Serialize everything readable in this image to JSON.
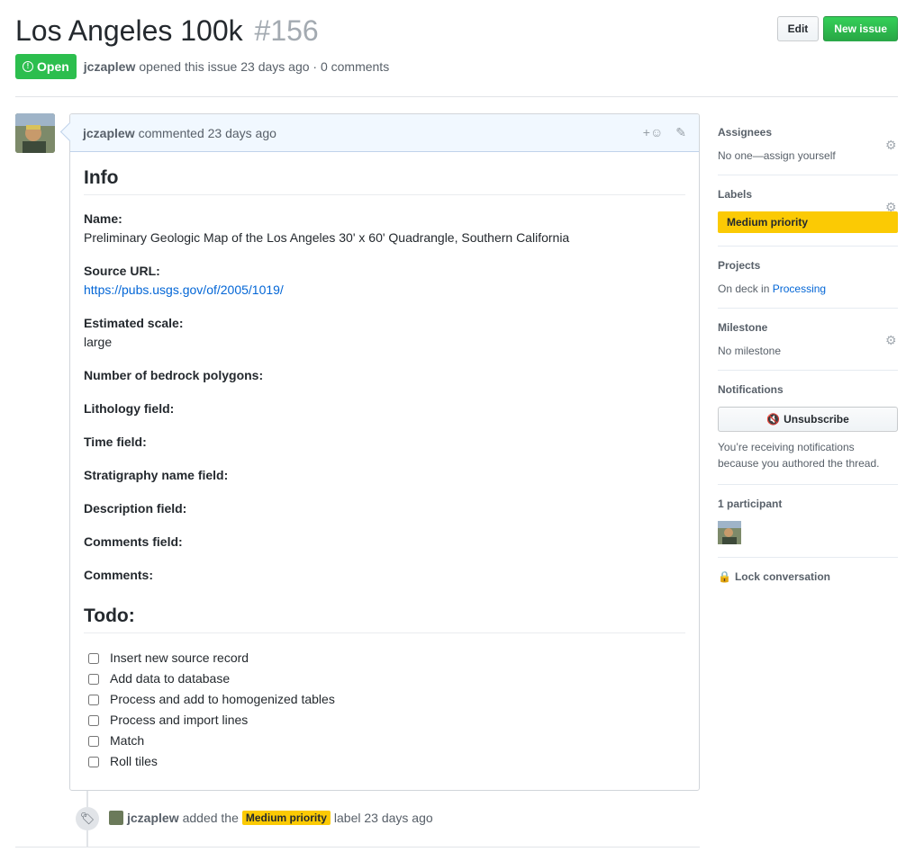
{
  "issue": {
    "title": "Los Angeles 100k",
    "number": "#156",
    "state": "Open",
    "author": "jczaplew",
    "opened_text": "opened this issue 23 days ago · 0 comments"
  },
  "actions": {
    "edit": "Edit",
    "new_issue": "New issue"
  },
  "comment": {
    "author": "jczaplew",
    "time": "commented 23 days ago",
    "info_heading": "Info",
    "fields": [
      {
        "label": "Name:",
        "value": "Preliminary Geologic Map of the Los Angeles 30' x 60' Quadrangle, Southern California"
      },
      {
        "label": "Source URL:",
        "value": "https://pubs.usgs.gov/of/2005/1019/"
      },
      {
        "label": "Estimated scale:",
        "value": "large"
      },
      {
        "label": "Number of bedrock polygons:",
        "value": ""
      },
      {
        "label": "Lithology field:",
        "value": ""
      },
      {
        "label": "Time field:",
        "value": ""
      },
      {
        "label": "Stratigraphy name field:",
        "value": ""
      },
      {
        "label": "Description field:",
        "value": ""
      },
      {
        "label": "Comments field:",
        "value": ""
      },
      {
        "label": "Comments:",
        "value": ""
      }
    ],
    "todo_heading": "Todo:",
    "todos": [
      "Insert new source record",
      "Add data to database",
      "Process and add to homogenized tables",
      "Process and import lines",
      "Match",
      "Roll tiles"
    ]
  },
  "event": {
    "author": "jczaplew",
    "pre": "added the",
    "label": "Medium priority",
    "post": "label 23 days ago"
  },
  "sidebar": {
    "assignees_title": "Assignees",
    "assignees_text": "No one—assign yourself",
    "labels_title": "Labels",
    "label": "Medium priority",
    "projects_title": "Projects",
    "projects_pre": "On deck in",
    "projects_link": "Processing",
    "milestone_title": "Milestone",
    "milestone_text": "No milestone",
    "notifications_title": "Notifications",
    "unsubscribe": "Unsubscribe",
    "notifications_note": "You’re receiving notifications because you authored the thread.",
    "participants_title": "1 participant",
    "lock": "Lock conversation"
  },
  "colors": {
    "open_green": "#2cbe4e",
    "label_yellow": "#fbca04",
    "link_blue": "#0366d6"
  }
}
